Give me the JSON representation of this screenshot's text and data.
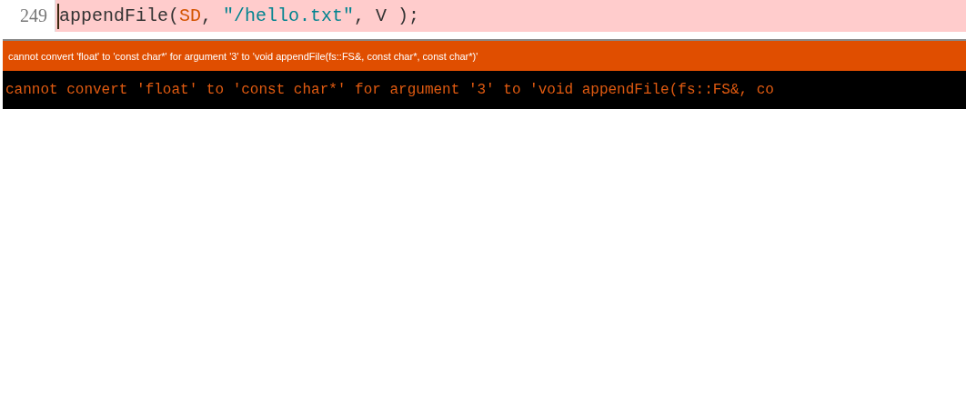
{
  "editor": {
    "line_number": "249",
    "error": true,
    "tokens": [
      {
        "kind": "plain",
        "text": "appendFile("
      },
      {
        "kind": "variable",
        "text": "SD"
      },
      {
        "kind": "plain",
        "text": ", "
      },
      {
        "kind": "string",
        "text": "\"/hello.txt\""
      },
      {
        "kind": "plain",
        "text": ", V );"
      }
    ]
  },
  "error_bar": {
    "message": "cannot convert 'float' to 'const char*' for argument '3' to 'void appendFile(fs::FS&, const char*, const char*)'"
  },
  "console": {
    "output": "cannot convert 'float' to 'const char*' for argument '3' to 'void appendFile(fs::FS&, co"
  }
}
